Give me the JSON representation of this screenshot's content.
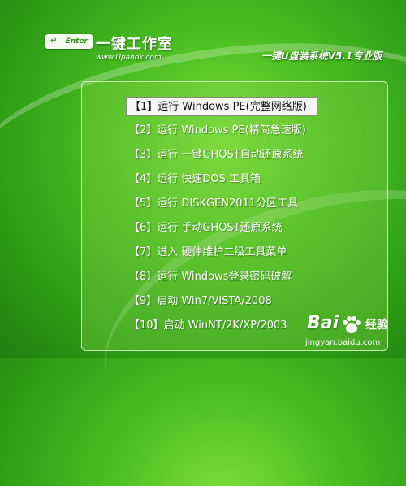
{
  "brand": {
    "key_label": "Enter",
    "title": "一键工作室",
    "url": "www.Upanok.com",
    "edition": "一键U盘装系统V5.1专业版"
  },
  "menu": {
    "items": [
      {
        "label": "【1】运行 Windows PE(完整网络版)",
        "selected": true
      },
      {
        "label": "【2】运行 Windows PE(精简急速版)"
      },
      {
        "label": "【3】运行 一键GHOST自动还原系统"
      },
      {
        "label": "【4】运行 快速DOS 工具箱"
      },
      {
        "label": "【5】运行 DISKGEN2011分区工具"
      },
      {
        "label": "【6】运行 手动GHOST还原系统"
      },
      {
        "label": "【7】进入 硬件维护二级工具菜单"
      },
      {
        "label": "【8】运行 Windows登录密码破解"
      },
      {
        "label": "【9】启动 Win7/VISTA/2008"
      },
      {
        "label": "【10】启动 WinNT/2K/XP/2003"
      }
    ]
  },
  "watermark": {
    "logo": "Bai",
    "logo_suffix": "经验",
    "domain": "jingyan.baidu.com",
    "icon": "baidu-paw-icon"
  },
  "colors": {
    "background": "#3fae1c",
    "selected_bg": "#f6f6f6",
    "text": "#ffffff"
  }
}
